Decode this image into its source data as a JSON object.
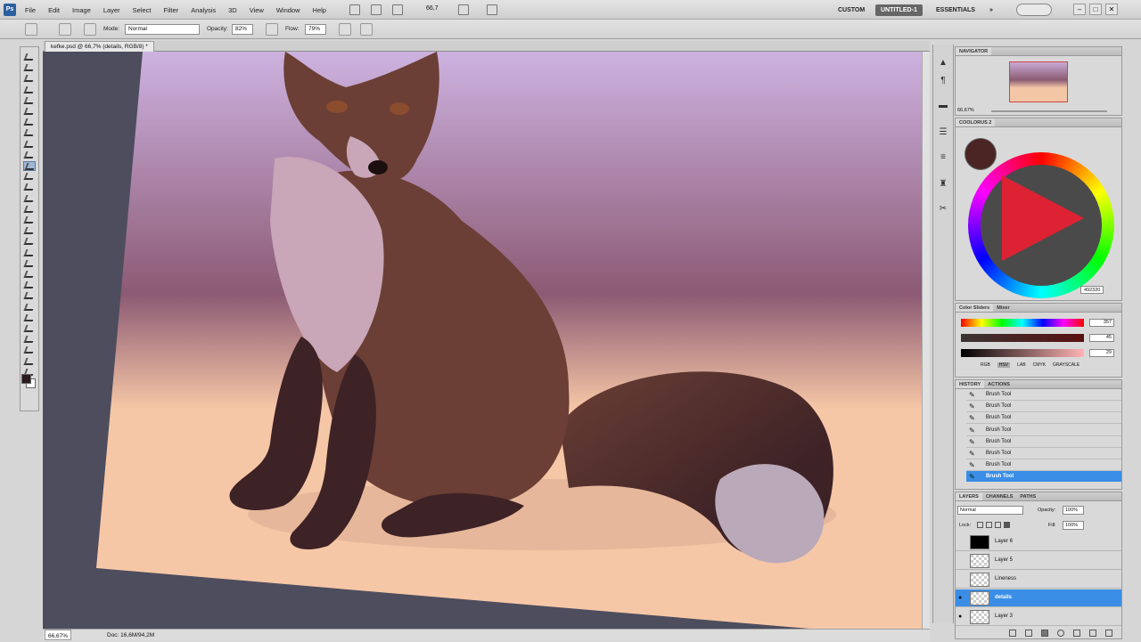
{
  "menubar": {
    "logo": "Ps",
    "menus": [
      "File",
      "Edit",
      "Image",
      "Layer",
      "Select",
      "Filter",
      "Analysis",
      "3D",
      "View",
      "Window",
      "Help"
    ],
    "zoom_level": "66,7",
    "workspaces": [
      "CUSTOM",
      "UNTITLED-1",
      "ESSENTIALS"
    ],
    "more_glyph": "»",
    "window_controls": [
      "–",
      "□",
      "✕"
    ]
  },
  "options_bar": {
    "mode_label": "Mode:",
    "mode_value": "Normal",
    "opacity_label": "Opacity:",
    "opacity_value": "82%",
    "flow_label": "Flow:",
    "flow_value": "79%"
  },
  "document": {
    "tab_title": "kefke.psd @ 66,7% (details, RGB/8) *",
    "zoom_status": "66,67%",
    "doc_status": "Doc: 16,6M/94,2M",
    "canvas_colors": {
      "sky_top": "#cdb2e0",
      "sky_mid": "#8c5a74",
      "ground": "#f6c7a6",
      "fox_body": "#6b3f35",
      "fox_light": "#c9a6b8",
      "tail_dark": "#3d2226",
      "tail_tip": "#b9a9b9"
    }
  },
  "tools": {
    "count": 30,
    "active_index": 10
  },
  "dock_icons": [
    "navigator-icon",
    "paragraph-icon",
    "swatch-icon",
    "layers-comp-icon",
    "adjust-icon",
    "stamp-icon",
    "scissors-icon"
  ],
  "navigator": {
    "title": "NAVIGATOR",
    "zoom": "66,67%"
  },
  "coolorus": {
    "title": "COOLORUS 2",
    "hex": "492320",
    "current_color": "#4b2424"
  },
  "color_sliders": {
    "tabs": [
      "Color Sliders",
      "Mixer"
    ],
    "values": [
      "357",
      "45",
      "29"
    ],
    "modes": [
      "RGB",
      "HSV",
      "LAB",
      "CMYK",
      "GRAYSCALE"
    ]
  },
  "history": {
    "tabs": [
      "HISTORY",
      "ACTIONS"
    ],
    "items": [
      "Brush Tool",
      "Brush Tool",
      "Brush Tool",
      "Brush Tool",
      "Brush Tool",
      "Brush Tool",
      "Brush Tool",
      "Brush Tool"
    ],
    "selected_index": 7
  },
  "layers": {
    "tabs": [
      "LAYERS",
      "CHANNELS",
      "PATHS"
    ],
    "blend_mode": "Normal",
    "opacity_label": "Opacity:",
    "opacity_value": "100%",
    "lock_label": "Lock:",
    "fill_label": "Fill:",
    "fill_value": "100%",
    "items": [
      {
        "name": "Layer 6",
        "visible": false,
        "selected": false
      },
      {
        "name": "Layer 5",
        "visible": false,
        "selected": false
      },
      {
        "name": "Lineness",
        "visible": false,
        "selected": false
      },
      {
        "name": "details",
        "visible": true,
        "selected": true
      },
      {
        "name": "Layer 3",
        "visible": true,
        "selected": false
      }
    ]
  }
}
